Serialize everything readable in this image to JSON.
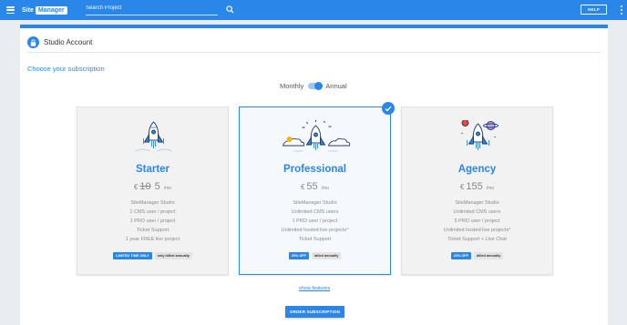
{
  "topbar": {
    "logo_part1": "Site",
    "logo_part2": "Manager",
    "search_placeholder": "Search Project",
    "help_label": "HELP"
  },
  "account": {
    "title": "Studio Account",
    "subtitle": "Choose your subscription"
  },
  "billing": {
    "monthly_label": "Monthly",
    "annual_label": "Annual",
    "selected": "Annual"
  },
  "plans": [
    {
      "name": "Starter",
      "currency": "€",
      "old_price": "10",
      "price": "5",
      "per": "/mo",
      "features": [
        "SiteManager Studio",
        "1 CMS user / project",
        "1 PRO user / project",
        "Ticket Support",
        "1 year FREE live project"
      ],
      "badge": "LIMITED TIME ONLY",
      "billing_note": "only billed annually",
      "selected": false
    },
    {
      "name": "Professional",
      "currency": "€",
      "old_price": "",
      "price": "55",
      "per": "/mo",
      "features": [
        "SiteManager Studio",
        "Unlimited CMS users",
        "1 PRO user / project",
        "Unlimited hosted live projects*",
        "Ticket Support"
      ],
      "badge": "20% OFF",
      "billing_note": "billed annually",
      "selected": true
    },
    {
      "name": "Agency",
      "currency": "€",
      "old_price": "",
      "price": "155",
      "per": "/mo",
      "features": [
        "SiteManager Studio",
        "Unlimited CMS users",
        "5 PRO user / project",
        "Unlimited hosted live projects*",
        "Ticket Support + Live Chat"
      ],
      "badge": "22% OFF",
      "billing_note": "billed annually",
      "selected": false
    }
  ],
  "show_features_label": "show features",
  "order_label": "ORDER SUBSCRIPTION",
  "colors": {
    "accent": "#2a86e9",
    "background": "#e9edf1"
  }
}
